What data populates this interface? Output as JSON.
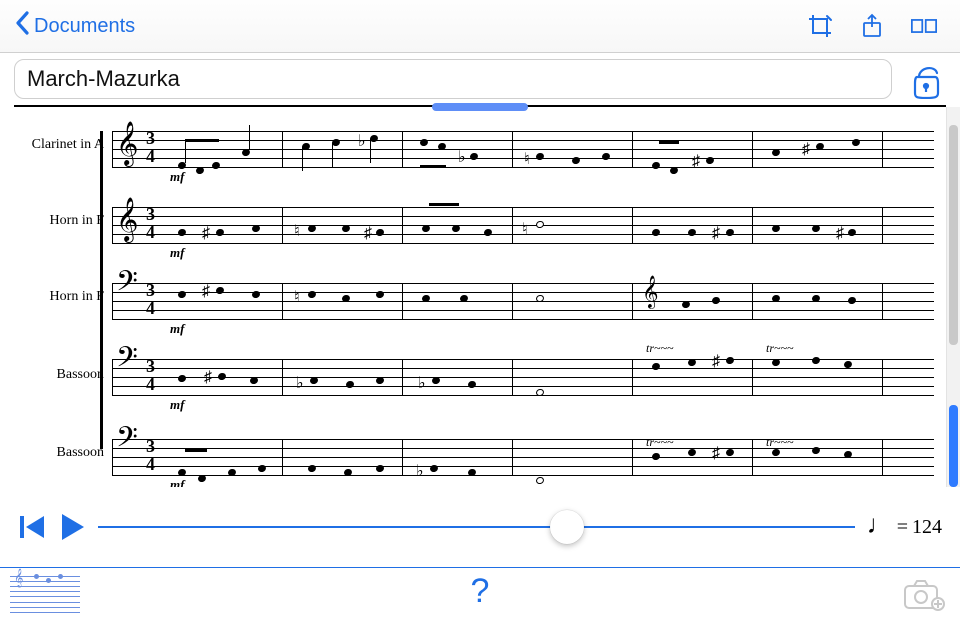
{
  "colors": {
    "accent": "#1f6fe5"
  },
  "topbar": {
    "back_label": "Documents",
    "icons": [
      "crop-icon",
      "share-icon",
      "layout-split-icon"
    ]
  },
  "title": {
    "value": "March-Mazurka"
  },
  "lock": {
    "state": "unlocked"
  },
  "score": {
    "time_signature": "3/4",
    "instruments": [
      {
        "label": "Clarinet in A",
        "clef": "treble",
        "dynamic": "mf"
      },
      {
        "label": "Horn in F",
        "clef": "treble",
        "dynamic": "mf"
      },
      {
        "label": "Horn in F",
        "clef": "bass",
        "dynamic": "mf"
      },
      {
        "label": "Bassoon",
        "clef": "bass",
        "dynamic": "mf"
      },
      {
        "label": "Bassoon",
        "clef": "bass",
        "dynamic": "mf"
      }
    ],
    "visible_measures": 6
  },
  "transport": {
    "slider_position_pct": 62,
    "tempo_note": "quarter",
    "tempo_label_prefix": "= ",
    "tempo_value": "124"
  },
  "bottombar": {
    "help_label": "?",
    "thumbnail": "score-thumbnail",
    "camera": "camera-add-icon"
  }
}
